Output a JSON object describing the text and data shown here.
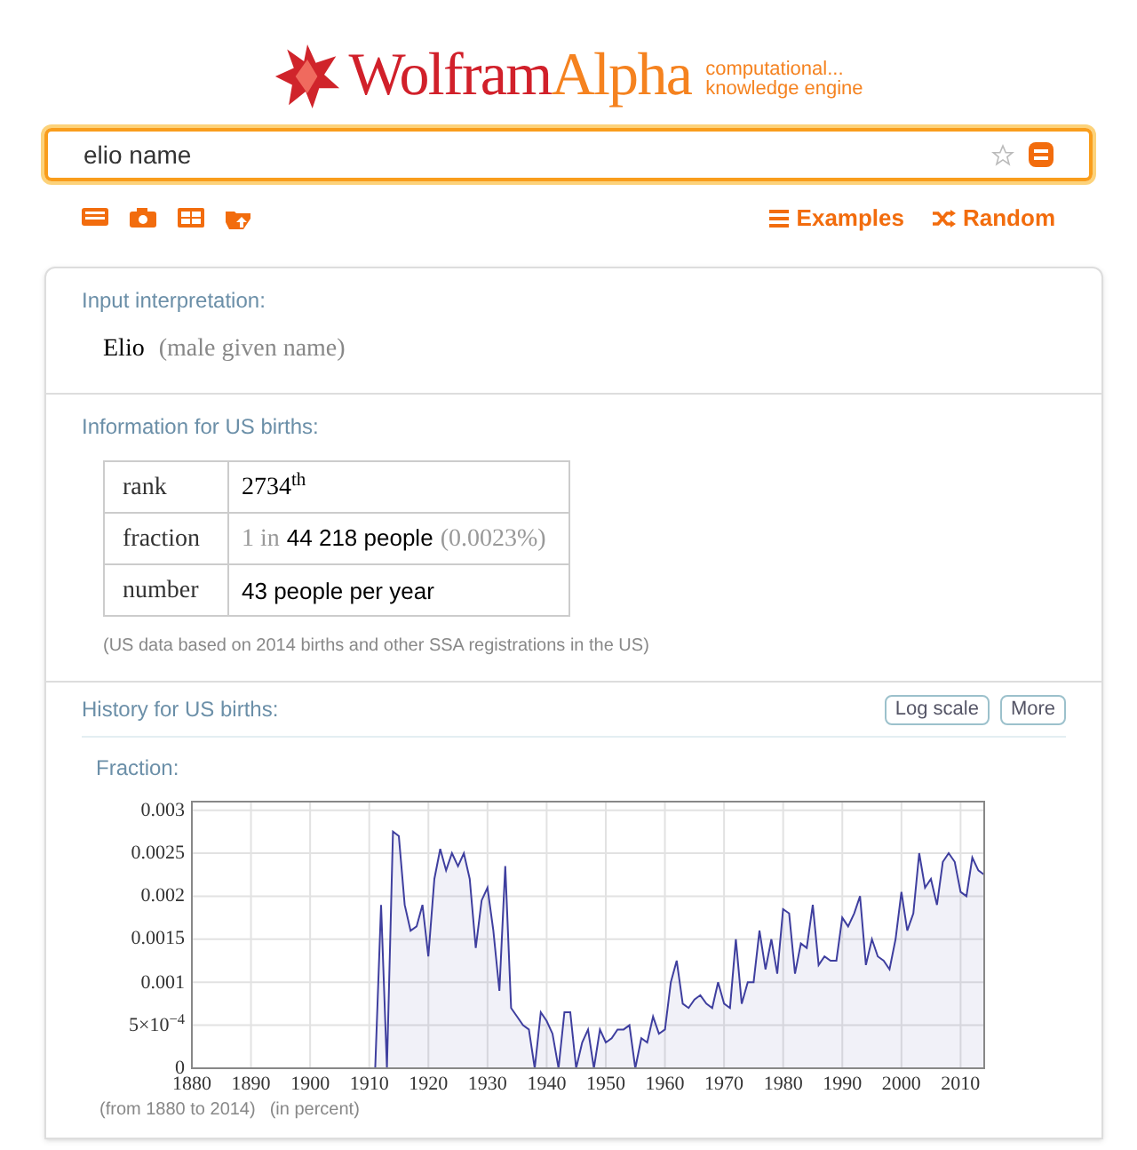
{
  "logo": {
    "word_1": "Wolfram",
    "word_2": "Alpha",
    "tagline_1": "computational...",
    "tagline_2": "knowledge engine"
  },
  "search": {
    "value": "elio name"
  },
  "links": [
    {
      "label": "Examples",
      "kind": "menu"
    },
    {
      "label": "Random",
      "kind": "shuffle"
    }
  ],
  "pods": {
    "input": {
      "title": "Input interpretation:",
      "name": "Elio",
      "note": "(male given name)"
    },
    "births": {
      "title": "Information for US births:",
      "rows": [
        {
          "label": "rank",
          "parts": [
            {
              "text": "2734$^{th}$",
              "kind": "main"
            }
          ]
        },
        {
          "label": "fraction",
          "parts": [
            {
              "text": "1 in",
              "kind": "muted"
            },
            {
              "text": "44 218 people",
              "kind": "sans"
            },
            {
              "text": "(0.0023%)",
              "kind": "muted"
            }
          ]
        },
        {
          "label": "number",
          "parts": [
            {
              "text": "43 people per year",
              "kind": "sans"
            }
          ]
        }
      ],
      "footnote": "(US data based on 2014 births and other SSA registrations in the US)"
    },
    "history": {
      "title": "History for US births:",
      "buttons": [
        "Log scale",
        "More"
      ],
      "subtitle": "Fraction:",
      "notes": [
        "(from 1880 to 2014)",
        "(in percent)"
      ],
      "chart_data": {
        "type": "area",
        "grid": true,
        "xlim": [
          1880,
          2014
        ],
        "ylim": [
          0,
          0.0031
        ],
        "xticks": [
          1880,
          1890,
          1900,
          1910,
          1920,
          1930,
          1940,
          1950,
          1960,
          1970,
          1980,
          1990,
          2000,
          2010
        ],
        "yticks": [
          0,
          {
            "value": 0.0005,
            "label": "5×10$^{−4}$"
          },
          0.001,
          0.0015,
          0.002,
          0.0025,
          0.003
        ],
        "x": [
          1880,
          1881,
          1882,
          1883,
          1884,
          1885,
          1886,
          1887,
          1888,
          1889,
          1890,
          1891,
          1892,
          1893,
          1894,
          1895,
          1896,
          1897,
          1898,
          1899,
          1900,
          1901,
          1902,
          1903,
          1904,
          1905,
          1906,
          1907,
          1908,
          1909,
          1910,
          1911,
          1912,
          1913,
          1914,
          1915,
          1916,
          1917,
          1918,
          1919,
          1920,
          1921,
          1922,
          1923,
          1924,
          1925,
          1926,
          1927,
          1928,
          1929,
          1930,
          1931,
          1932,
          1933,
          1934,
          1935,
          1936,
          1937,
          1938,
          1939,
          1940,
          1941,
          1942,
          1943,
          1944,
          1945,
          1946,
          1947,
          1948,
          1949,
          1950,
          1951,
          1952,
          1953,
          1954,
          1955,
          1956,
          1957,
          1958,
          1959,
          1960,
          1961,
          1962,
          1963,
          1964,
          1965,
          1966,
          1967,
          1968,
          1969,
          1970,
          1971,
          1972,
          1973,
          1974,
          1975,
          1976,
          1977,
          1978,
          1979,
          1980,
          1981,
          1982,
          1983,
          1984,
          1985,
          1986,
          1987,
          1988,
          1989,
          1990,
          1991,
          1992,
          1993,
          1994,
          1995,
          1996,
          1997,
          1998,
          1999,
          2000,
          2001,
          2002,
          2003,
          2004,
          2005,
          2006,
          2007,
          2008,
          2009,
          2010,
          2011,
          2012,
          2013,
          2014
        ],
        "series": [
          {
            "color": "#3f3f9f",
            "values": [
              0,
              0,
              0,
              0,
              0,
              0,
              0,
              0,
              0,
              0,
              0,
              0,
              0,
              0,
              0,
              0,
              0,
              0,
              0,
              0,
              0,
              0,
              0,
              0,
              0,
              0,
              0,
              0,
              0,
              0,
              0,
              0,
              0.0019,
              0,
              0.00275,
              0.0027,
              0.0019,
              0.0016,
              0.00165,
              0.0019,
              0.0013,
              0.0022,
              0.00255,
              0.0023,
              0.0025,
              0.00235,
              0.0025,
              0.0022,
              0.0014,
              0.00195,
              0.0021,
              0.0016,
              0.0009,
              0.00235,
              0.0007,
              0.0006,
              0.0005,
              0.00045,
              0,
              0.00065,
              0.00055,
              0.0004,
              0,
              0.00065,
              0.00065,
              0,
              0.0003,
              0.00045,
              0,
              0.00045,
              0.0003,
              0.00035,
              0.00045,
              0.00045,
              0.0005,
              0,
              0.00035,
              0.0003,
              0.0006,
              0.0004,
              0.00045,
              0.001,
              0.00125,
              0.00075,
              0.0007,
              0.0008,
              0.00085,
              0.00075,
              0.0007,
              0.001,
              0.00075,
              0.0007,
              0.0015,
              0.00075,
              0.001,
              0.001,
              0.0016,
              0.00115,
              0.0015,
              0.0011,
              0.00185,
              0.0018,
              0.0011,
              0.00145,
              0.0014,
              0.0019,
              0.0012,
              0.0013,
              0.00125,
              0.00125,
              0.00175,
              0.00165,
              0.0018,
              0.002,
              0.0012,
              0.0015,
              0.0013,
              0.00125,
              0.00115,
              0.0015,
              0.00205,
              0.0016,
              0.0018,
              0.0025,
              0.0021,
              0.0022,
              0.0019,
              0.0024,
              0.0025,
              0.0024,
              0.00205,
              0.002,
              0.00245,
              0.0023,
              0.00225
            ]
          }
        ]
      }
    }
  }
}
